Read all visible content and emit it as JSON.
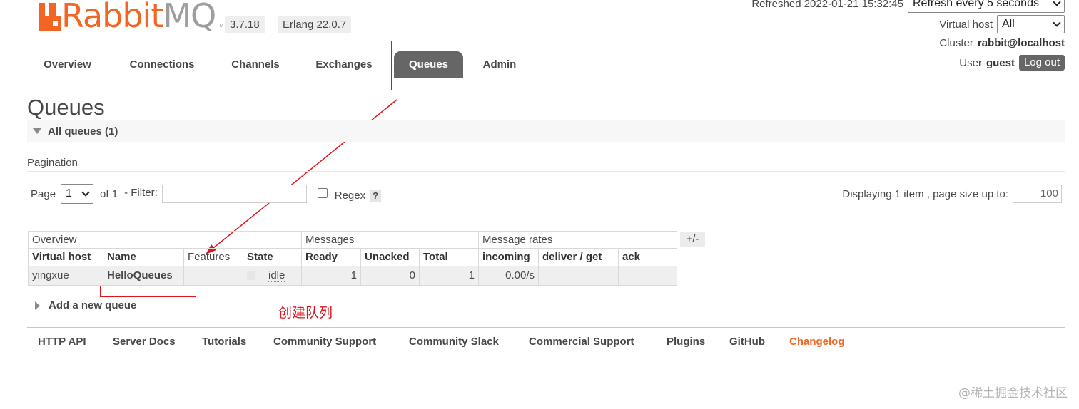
{
  "app": {
    "logo_primary": "Rabbit",
    "logo_secondary": "MQ",
    "logo_tm": "TM",
    "version": "3.7.18",
    "erlang": "Erlang 22.0.7"
  },
  "status": {
    "refreshed_label": "Refreshed 2022-01-21 15:32:45",
    "refresh_select": "Refresh every 5 seconds",
    "vhost_label": "Virtual host",
    "vhost_value": "All",
    "cluster_label": "Cluster",
    "cluster_value": "rabbit@localhost",
    "user_label": "User",
    "user_value": "guest",
    "logout": "Log out"
  },
  "nav": {
    "tabs": [
      {
        "label": "Overview"
      },
      {
        "label": "Connections"
      },
      {
        "label": "Channels"
      },
      {
        "label": "Exchanges"
      },
      {
        "label": "Queues",
        "active": true
      },
      {
        "label": "Admin"
      }
    ]
  },
  "page": {
    "title": "Queues",
    "section": "All queues (1)"
  },
  "pagination": {
    "label": "Pagination",
    "page_label": "Page",
    "page_value": "1",
    "of_label": "of 1",
    "filter_label": "- Filter:",
    "filter_value": "",
    "regex_label": "Regex",
    "help": "?",
    "displaying": "Displaying 1 item , page size up to:",
    "page_size": "100"
  },
  "table": {
    "groups": [
      "Overview",
      "Messages",
      "Message rates"
    ],
    "toggle": "+/-",
    "columns": [
      "Virtual host",
      "Name",
      "Features",
      "State",
      "Ready",
      "Unacked",
      "Total",
      "incoming",
      "deliver / get",
      "ack"
    ],
    "rows": [
      {
        "vhost": "yingxue",
        "name": "HelloQueues",
        "features": "",
        "state": "idle",
        "ready": "1",
        "unacked": "0",
        "total": "1",
        "incoming": "0.00/s",
        "deliver_get": "",
        "ack": ""
      }
    ]
  },
  "add_queue": "Add a new queue",
  "annotation": "创建队列",
  "footer": {
    "links": [
      "HTTP API",
      "Server Docs",
      "Tutorials",
      "Community Support",
      "Community Slack",
      "Commercial Support",
      "Plugins",
      "GitHub",
      "Changelog"
    ]
  },
  "watermark": "@稀土掘金技术社区",
  "colors": {
    "brand_orange": "#f26522",
    "tab_active": "#666666",
    "annotation_red": "#e0141b"
  }
}
